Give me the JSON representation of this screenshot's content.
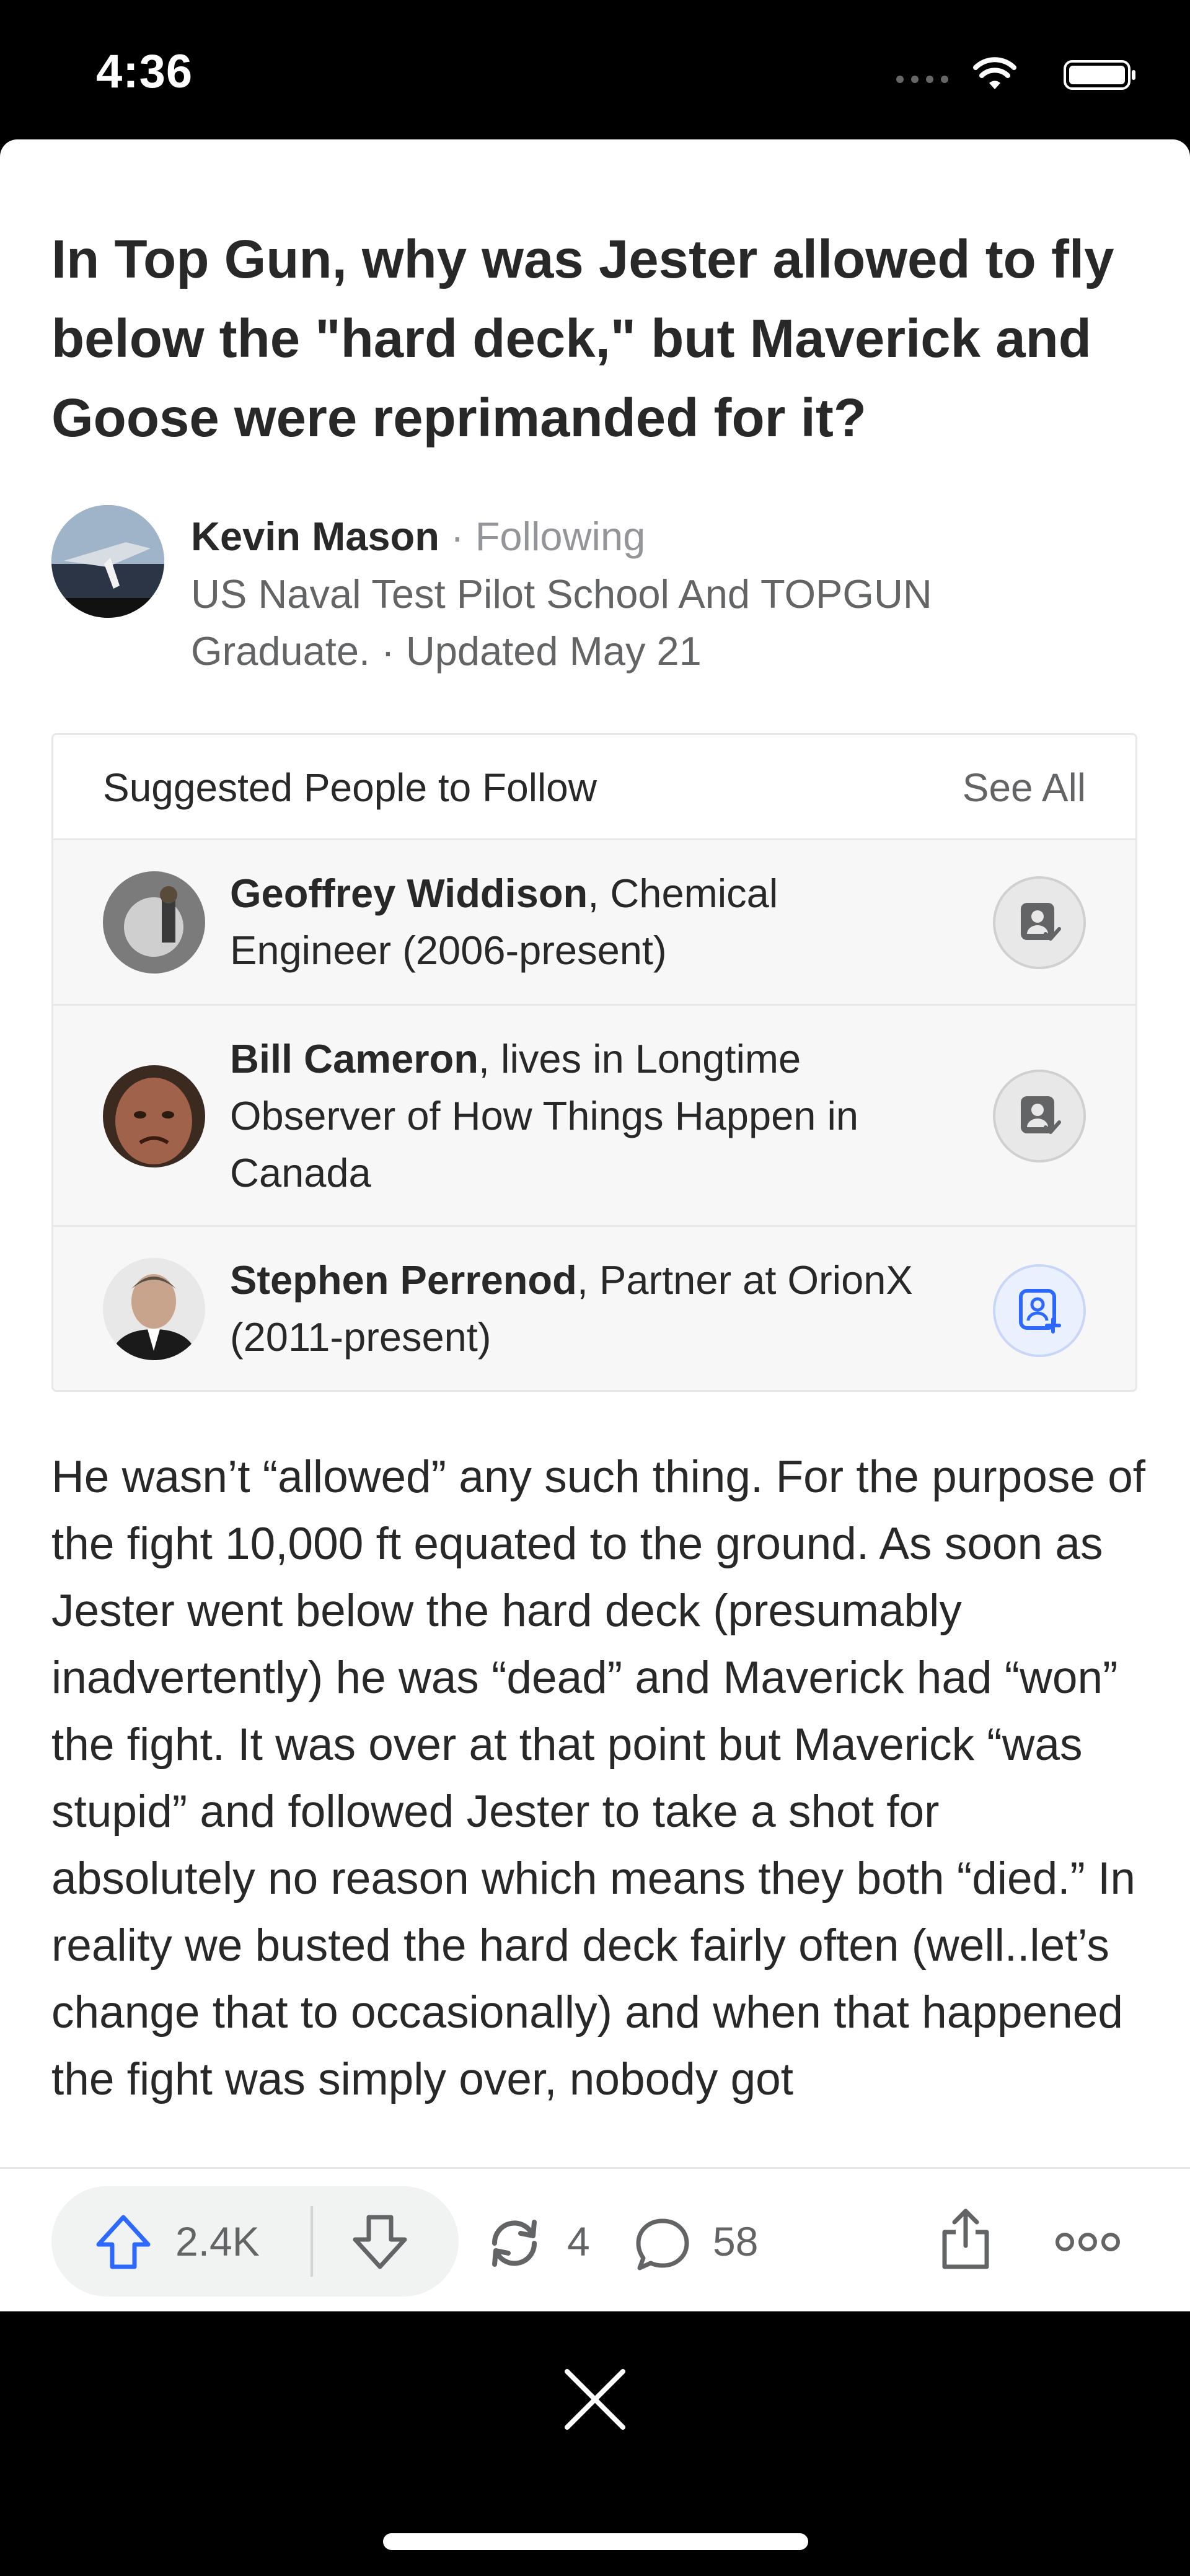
{
  "status_bar": {
    "time": "4:36"
  },
  "question": {
    "title": "In Top Gun, why was Jester allowed to fly below the \"hard deck,\" but Maverick and Goose were reprimanded for it?"
  },
  "author": {
    "name": "Kevin Mason",
    "separator": " · ",
    "follow_status": "Following",
    "credential": "US Naval Test Pilot School And TOPGUN Graduate. · Updated May 21"
  },
  "suggested": {
    "title": "Suggested People to Follow",
    "see_all": "See All",
    "people": [
      {
        "name": "Geoffrey Widdison",
        "credential": ", Chemical Engineer (2006-present)",
        "following": true
      },
      {
        "name": "Bill Cameron",
        "credential": ", lives in Longtime Observer of How Things Happen in Canada",
        "following": true
      },
      {
        "name": "Stephen Perrenod",
        "credential": ", Partner at OrionX (2011-present)",
        "following": false
      }
    ]
  },
  "answer": {
    "text": "He wasn’t “allowed” any such thing. For the purpose of the fight 10,000 ft equated to the ground. As soon as Jester went below the hard deck (presumably inadvertently) he was “dead” and Maverick had “won” the fight. It was over at that point but Maverick “was stupid” and followed Jester to take a shot for absolutely no reason which means they both “died.” In reality we busted the hard deck fairly often (well..let’s change that to occasionally) and when that happened the fight was simply over, nobody got"
  },
  "actions": {
    "upvotes": "2.4K",
    "reshares": "4",
    "comments": "58"
  },
  "colors": {
    "upvote_blue": "#2e69ff",
    "icon_gray": "#636466"
  },
  "icons": [
    "upvote-icon",
    "downvote-icon",
    "reshare-icon",
    "comment-icon",
    "share-icon",
    "more-icon",
    "close-icon",
    "follow-person-icon",
    "followed-person-icon"
  ]
}
